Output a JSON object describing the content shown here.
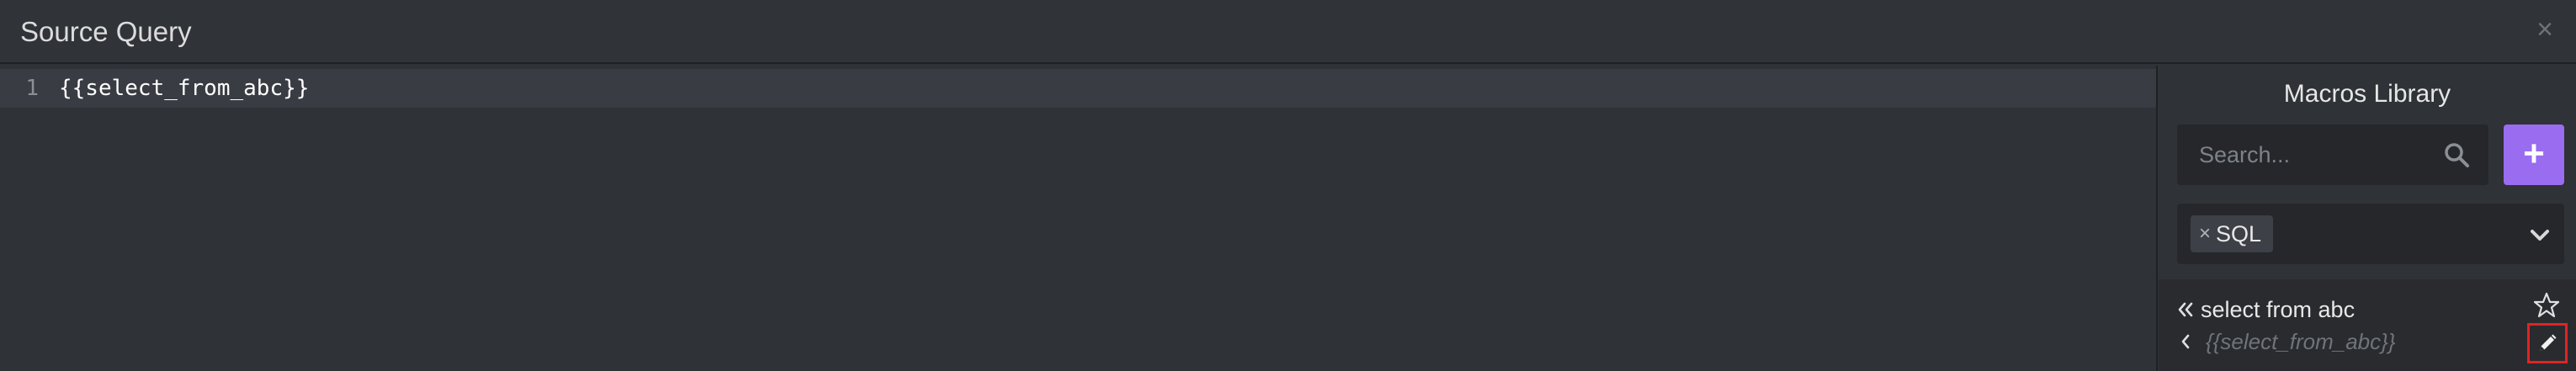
{
  "header": {
    "title": "Source Query",
    "close_label": "×"
  },
  "editor": {
    "lines": [
      {
        "number": "1",
        "text": "{{select_from_abc}}"
      }
    ]
  },
  "panel": {
    "title": "Macros Library",
    "search": {
      "placeholder": "Search...",
      "value": ""
    },
    "add_label": "+",
    "filter": {
      "tags": [
        {
          "remove": "×",
          "label": "SQL"
        }
      ]
    },
    "macros": [
      {
        "name": "select from abc",
        "snippet": "{{select_from_abc}}"
      }
    ]
  },
  "icons": {
    "close": "close-icon",
    "search": "search-icon",
    "add": "plus-icon",
    "chevron": "chevron-down-icon",
    "star": "star-icon",
    "edit": "pencil-icon"
  },
  "colors": {
    "accent": "#9a6cf0",
    "highlight_border": "#e02424"
  }
}
